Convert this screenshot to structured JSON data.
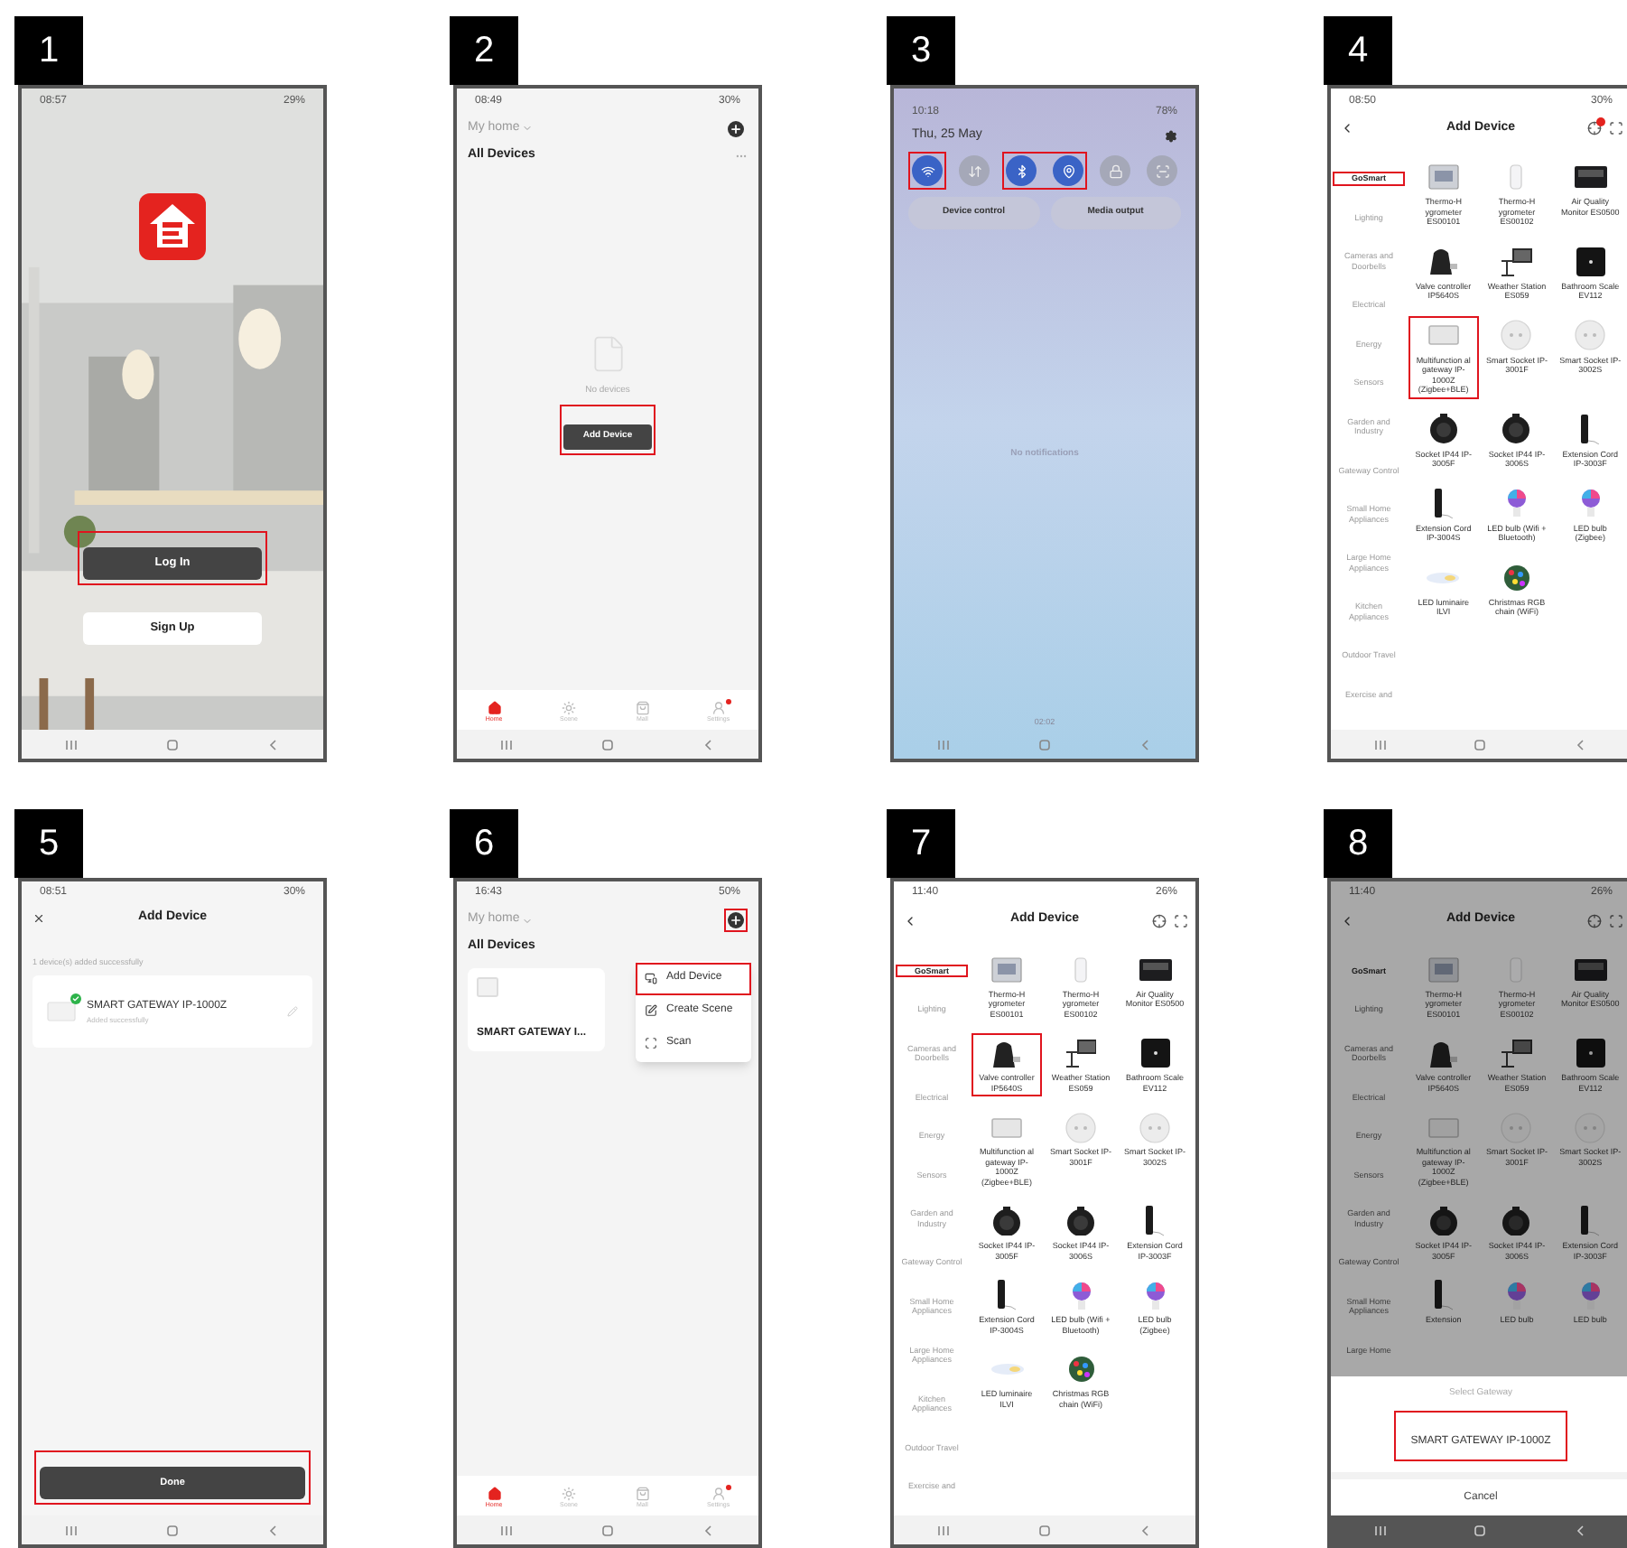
{
  "panels": [
    {
      "number": "1",
      "kind": "login",
      "status_bar": {
        "time": "08:57",
        "battery": "29%"
      },
      "buttons": [
        {
          "label": "Log In",
          "kind": "primary",
          "highlighted": true
        },
        {
          "label": "Sign Up",
          "kind": "secondary",
          "highlighted": false
        }
      ]
    },
    {
      "number": "2",
      "kind": "home",
      "status_bar": {
        "time": "08:49",
        "battery": "30%"
      },
      "home_label": "My home",
      "add_highlighted": false,
      "section_title": "All Devices",
      "empty_text": "No devices",
      "add_button": {
        "label": "Add Device",
        "highlighted": true
      },
      "tabs": [
        {
          "label": "Home",
          "selected": true,
          "badge": false
        },
        {
          "label": "Scene",
          "selected": false,
          "badge": false
        },
        {
          "label": "Mall",
          "selected": false,
          "badge": false
        },
        {
          "label": "Settings",
          "selected": false,
          "badge": true
        }
      ]
    },
    {
      "number": "3",
      "kind": "quick_panel",
      "status_bar": {
        "time": "10:18",
        "battery": "78%"
      },
      "date": "Thu, 25 May",
      "toggles": [
        {
          "on": true,
          "highlighted": true
        },
        {
          "on": false,
          "highlighted": false
        },
        {
          "on": true,
          "highlighted": true
        },
        {
          "on": true,
          "highlighted": true
        },
        {
          "on": false,
          "highlighted": false
        },
        {
          "on": false,
          "highlighted": false
        }
      ],
      "pills": [
        "Device control",
        "Media output"
      ],
      "empty_text": "No notifications",
      "footer": "02:02"
    },
    {
      "number": "4",
      "kind": "add_device",
      "status_bar": {
        "time": "08:50",
        "battery": "30%"
      },
      "title": "Add Device",
      "alert": true,
      "dimmed": false,
      "categories": [
        {
          "label": "GoSmart",
          "selected": true,
          "highlighted": true
        },
        {
          "label": "Lighting",
          "selected": false,
          "highlighted": false
        },
        {
          "label": "Cameras and Doorbells",
          "selected": false,
          "highlighted": false
        },
        {
          "label": "Electrical",
          "selected": false,
          "highlighted": false
        },
        {
          "label": "Energy",
          "selected": false,
          "highlighted": false
        },
        {
          "label": "Sensors",
          "selected": false,
          "highlighted": false
        },
        {
          "label": "Garden and Industry",
          "selected": false,
          "highlighted": false
        },
        {
          "label": "Gateway Control",
          "selected": false,
          "highlighted": false
        },
        {
          "label": "Small Home Appliances",
          "selected": false,
          "highlighted": false
        },
        {
          "label": "Large Home Appliances",
          "selected": false,
          "highlighted": false
        },
        {
          "label": "Kitchen Appliances",
          "selected": false,
          "highlighted": false
        },
        {
          "label": "Outdoor Travel",
          "selected": false,
          "highlighted": false
        },
        {
          "label": "Exercise and",
          "selected": false,
          "highlighted": false
        }
      ],
      "devices": [
        {
          "name": "Thermo-H ygrometer ES00101",
          "highlighted": false
        },
        {
          "name": "Thermo-H ygrometer ES00102",
          "highlighted": false
        },
        {
          "name": "Air Quality Monitor ES0500",
          "highlighted": false
        },
        {
          "name": "Valve controller IP5640S",
          "highlighted": false
        },
        {
          "name": "Weather Station ES059",
          "highlighted": false
        },
        {
          "name": "Bathroom Scale EV112",
          "highlighted": false
        },
        {
          "name": "Multifunction al gateway IP-1000Z (Zigbee+BLE)",
          "highlighted": true
        },
        {
          "name": "Smart Socket IP-3001F",
          "highlighted": false
        },
        {
          "name": "Smart Socket IP-3002S",
          "highlighted": false
        },
        {
          "name": "Socket IP44 IP-3005F",
          "highlighted": false
        },
        {
          "name": "Socket IP44 IP-3006S",
          "highlighted": false
        },
        {
          "name": "Extension Cord IP-3003F",
          "highlighted": false
        },
        {
          "name": "Extension Cord IP-3004S",
          "highlighted": false
        },
        {
          "name": "LED bulb (Wifi + Bluetooth)",
          "highlighted": false
        },
        {
          "name": "LED bulb (Zigbee)",
          "highlighted": false
        },
        {
          "name": "LED luminaire ILVI",
          "highlighted": false
        },
        {
          "name": "Christmas RGB chain (WiFi)",
          "highlighted": false
        }
      ]
    },
    {
      "number": "5",
      "kind": "added",
      "status_bar": {
        "time": "08:51",
        "battery": "30%"
      },
      "title": "Add Device",
      "summary": "1 device(s) added successfully",
      "device": {
        "name": "SMART GATEWAY IP-1000Z",
        "status": "Added successfully"
      },
      "done_button": {
        "label": "Done",
        "highlighted": true
      }
    },
    {
      "number": "6",
      "kind": "home",
      "status_bar": {
        "time": "16:43",
        "battery": "50%"
      },
      "home_label": "My home",
      "add_highlighted": true,
      "section_title": "All Devices",
      "devices": [
        {
          "name": "SMART GATEWAY I..."
        }
      ],
      "menu": [
        {
          "label": "Add Device",
          "highlighted": true
        },
        {
          "label": "Create Scene",
          "highlighted": false
        },
        {
          "label": "Scan",
          "highlighted": false
        }
      ],
      "tabs": [
        {
          "label": "Home",
          "selected": true,
          "badge": false
        },
        {
          "label": "Scene",
          "selected": false,
          "badge": false
        },
        {
          "label": "Mall",
          "selected": false,
          "badge": false
        },
        {
          "label": "Settings",
          "selected": false,
          "badge": true
        }
      ]
    },
    {
      "number": "7",
      "kind": "add_device",
      "status_bar": {
        "time": "11:40",
        "battery": "26%"
      },
      "title": "Add Device",
      "alert": false,
      "dimmed": false,
      "categories": [
        {
          "label": "GoSmart",
          "selected": true,
          "highlighted": true
        },
        {
          "label": "Lighting",
          "selected": false,
          "highlighted": false
        },
        {
          "label": "Cameras and Doorbells",
          "selected": false,
          "highlighted": false
        },
        {
          "label": "Electrical",
          "selected": false,
          "highlighted": false
        },
        {
          "label": "Energy",
          "selected": false,
          "highlighted": false
        },
        {
          "label": "Sensors",
          "selected": false,
          "highlighted": false
        },
        {
          "label": "Garden and Industry",
          "selected": false,
          "highlighted": false
        },
        {
          "label": "Gateway Control",
          "selected": false,
          "highlighted": false
        },
        {
          "label": "Small Home Appliances",
          "selected": false,
          "highlighted": false
        },
        {
          "label": "Large Home Appliances",
          "selected": false,
          "highlighted": false
        },
        {
          "label": "Kitchen Appliances",
          "selected": false,
          "highlighted": false
        },
        {
          "label": "Outdoor Travel",
          "selected": false,
          "highlighted": false
        },
        {
          "label": "Exercise and",
          "selected": false,
          "highlighted": false
        }
      ],
      "devices": [
        {
          "name": "Thermo-H ygrometer ES00101",
          "highlighted": false
        },
        {
          "name": "Thermo-H ygrometer ES00102",
          "highlighted": false
        },
        {
          "name": "Air Quality Monitor ES0500",
          "highlighted": false
        },
        {
          "name": "Valve controller IP5640S",
          "highlighted": true
        },
        {
          "name": "Weather Station ES059",
          "highlighted": false
        },
        {
          "name": "Bathroom Scale EV112",
          "highlighted": false
        },
        {
          "name": "Multifunction al gateway IP-1000Z (Zigbee+BLE)",
          "highlighted": false
        },
        {
          "name": "Smart Socket IP-3001F",
          "highlighted": false
        },
        {
          "name": "Smart Socket IP-3002S",
          "highlighted": false
        },
        {
          "name": "Socket IP44 IP-3005F",
          "highlighted": false
        },
        {
          "name": "Socket IP44 IP-3006S",
          "highlighted": false
        },
        {
          "name": "Extension Cord IP-3003F",
          "highlighted": false
        },
        {
          "name": "Extension Cord IP-3004S",
          "highlighted": false
        },
        {
          "name": "LED bulb (Wifi + Bluetooth)",
          "highlighted": false
        },
        {
          "name": "LED bulb (Zigbee)",
          "highlighted": false
        },
        {
          "name": "LED luminaire ILVI",
          "highlighted": false
        },
        {
          "name": "Christmas RGB chain (WiFi)",
          "highlighted": false
        }
      ]
    },
    {
      "number": "8",
      "kind": "add_device",
      "status_bar": {
        "time": "11:40",
        "battery": "26%"
      },
      "title": "Add Device",
      "alert": false,
      "dimmed": true,
      "categories": [
        {
          "label": "GoSmart",
          "selected": true,
          "highlighted": false
        },
        {
          "label": "Lighting",
          "selected": false,
          "highlighted": false
        },
        {
          "label": "Cameras and Doorbells",
          "selected": false,
          "highlighted": false
        },
        {
          "label": "Electrical",
          "selected": false,
          "highlighted": false
        },
        {
          "label": "Energy",
          "selected": false,
          "highlighted": false
        },
        {
          "label": "Sensors",
          "selected": false,
          "highlighted": false
        },
        {
          "label": "Garden and Industry",
          "selected": false,
          "highlighted": false
        },
        {
          "label": "Gateway Control",
          "selected": false,
          "highlighted": false
        },
        {
          "label": "Small Home Appliances",
          "selected": false,
          "highlighted": false
        },
        {
          "label": "Large Home",
          "selected": false,
          "highlighted": false
        }
      ],
      "devices": [
        {
          "name": "Thermo-H ygrometer ES00101",
          "highlighted": false
        },
        {
          "name": "Thermo-H ygrometer ES00102",
          "highlighted": false
        },
        {
          "name": "Air Quality Monitor ES0500",
          "highlighted": false
        },
        {
          "name": "Valve controller IP5640S",
          "highlighted": false
        },
        {
          "name": "Weather Station ES059",
          "highlighted": false
        },
        {
          "name": "Bathroom Scale EV112",
          "highlighted": false
        },
        {
          "name": "Multifunction al gateway IP-1000Z (Zigbee+BLE)",
          "highlighted": false
        },
        {
          "name": "Smart Socket IP-3001F",
          "highlighted": false
        },
        {
          "name": "Smart Socket IP-3002S",
          "highlighted": false
        },
        {
          "name": "Socket IP44 IP-3005F",
          "highlighted": false
        },
        {
          "name": "Socket IP44 IP-3006S",
          "highlighted": false
        },
        {
          "name": "Extension Cord IP-3003F",
          "highlighted": false
        },
        {
          "name": "Extension",
          "highlighted": false
        },
        {
          "name": "LED bulb",
          "highlighted": false
        },
        {
          "name": "LED bulb",
          "highlighted": false
        }
      ],
      "sheet": {
        "title": "Select Gateway",
        "option": "SMART GATEWAY IP-1000Z",
        "option_highlighted": true,
        "cancel": "Cancel"
      }
    }
  ]
}
